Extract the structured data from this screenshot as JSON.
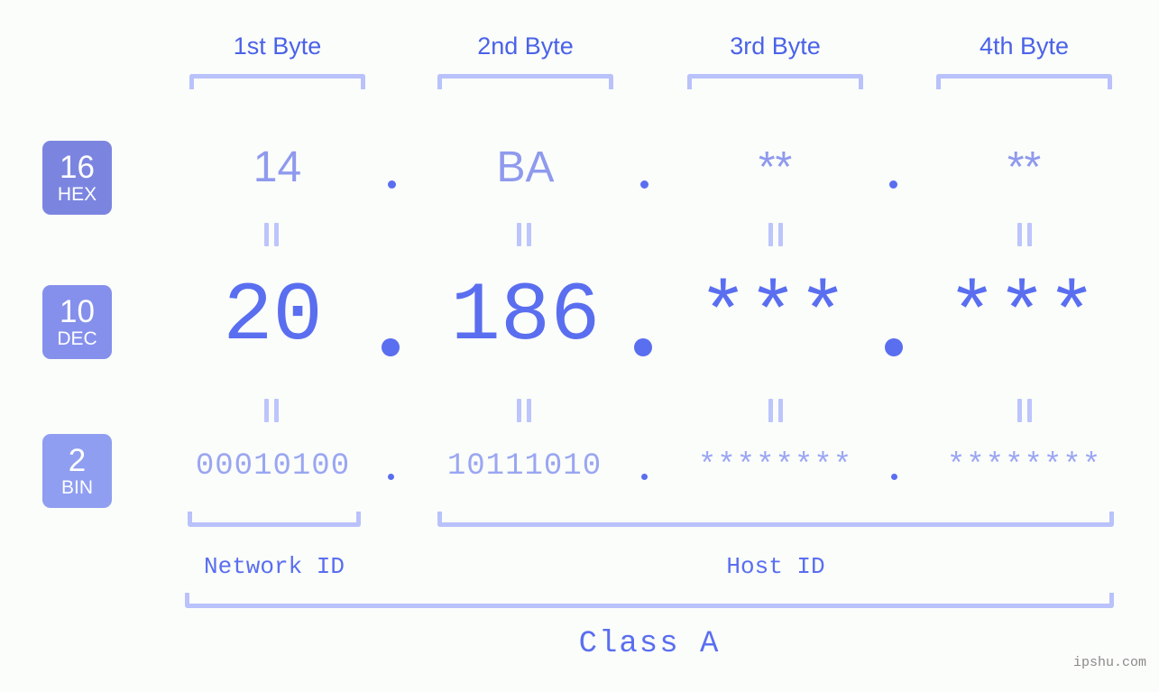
{
  "theme": {
    "background": "#fbfdfa",
    "accent_strong": "#4a62e8",
    "accent_dec": "#5a6ef0",
    "accent_light": "#8f9aee",
    "accent_bin": "#9aa6f2",
    "bracket": "#b9c2fb",
    "watermark": "#8a8a8a"
  },
  "header": {
    "bytes": [
      {
        "label": "1st Byte"
      },
      {
        "label": "2nd Byte"
      },
      {
        "label": "3rd Byte"
      },
      {
        "label": "4th Byte"
      }
    ]
  },
  "radix_badges": [
    {
      "number": "16",
      "name": "HEX",
      "color": "#7b85e0"
    },
    {
      "number": "10",
      "name": "DEC",
      "color": "#8590ec"
    },
    {
      "number": "2",
      "name": "BIN",
      "color": "#8f9ef0"
    }
  ],
  "rows": {
    "hex": {
      "radix": "16",
      "radix_name": "HEX",
      "values": [
        "14",
        "BA",
        "**",
        "**"
      ]
    },
    "dec": {
      "radix": "10",
      "radix_name": "DEC",
      "values": [
        "20",
        "186",
        "***",
        "***"
      ]
    },
    "bin": {
      "radix": "2",
      "radix_name": "BIN",
      "values": [
        "00010100",
        "10111010",
        "********",
        "********"
      ]
    }
  },
  "separators": {
    "dot": ".",
    "equals": "||"
  },
  "sections": {
    "network_id": "Network ID",
    "host_id": "Host ID",
    "class": "Class A"
  },
  "watermark": "ipshu.com",
  "chart_data": {
    "type": "table",
    "title": "IP Address Byte Breakdown",
    "columns": [
      "1st Byte",
      "2nd Byte",
      "3rd Byte",
      "4th Byte"
    ],
    "rows": [
      {
        "radix": "16 HEX",
        "cells": [
          "14",
          "BA",
          "**",
          "**"
        ]
      },
      {
        "radix": "10 DEC",
        "cells": [
          "20",
          "186",
          "***",
          "***"
        ]
      },
      {
        "radix": "2 BIN",
        "cells": [
          "00010100",
          "10111010",
          "********",
          "********"
        ]
      }
    ],
    "network_id_bytes": 1,
    "host_id_bytes": 3,
    "address_class": "Class A"
  }
}
